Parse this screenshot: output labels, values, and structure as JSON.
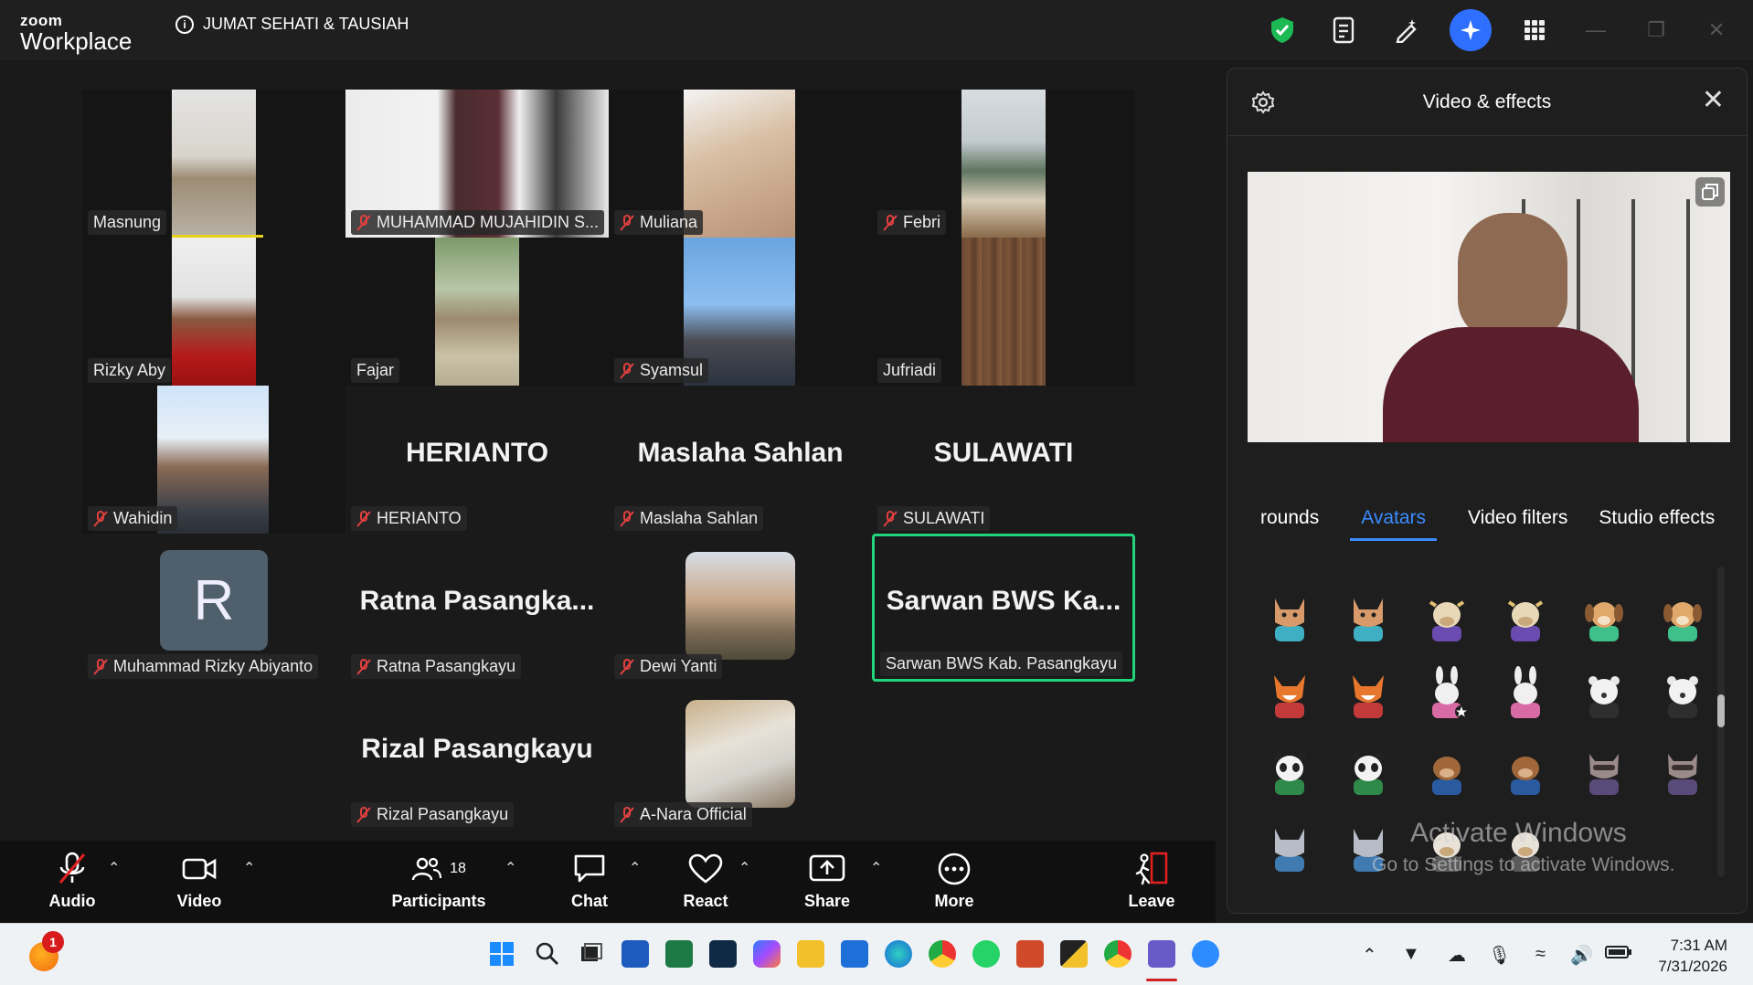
{
  "titlebar": {
    "brand_top": "zoom",
    "brand_bottom": "Workplace",
    "meeting_title": "JUMAT SEHATI & TAUSIAH",
    "icons": [
      "shield-check-icon",
      "notes-icon",
      "whiteboard-pen-icon",
      "ai-companion-icon",
      "apps-grid-icon"
    ]
  },
  "participants": {
    "masnung": "Masnung",
    "mujahidin": "MUHAMMAD MUJAHIDIN S...",
    "muliana": "Muliana",
    "febri": "Febri",
    "rizky_aby": "Rizky Aby",
    "fajar": "Fajar",
    "syamsul": "Syamsul",
    "jufriadi": "Jufriadi",
    "wahidin": "Wahidin",
    "herianto_big": "HERIANTO",
    "herianto": "HERIANTO",
    "maslaha_big": "Maslaha Sahlan",
    "maslaha": "Maslaha Sahlan",
    "sulawati_big": "SULAWATI",
    "sulawati": "SULAWATI",
    "rizky_abiyanto_initial": "R",
    "rizky_abiyanto": "Muhammad Rizky Abiyanto",
    "ratna_big": "Ratna  Pasangka...",
    "ratna": "Ratna Pasangkayu",
    "dewi": "Dewi Yanti",
    "sarwan_big": "Sarwan  BWS  Ka...",
    "sarwan": "Sarwan BWS Kab. Pasangkayu",
    "rizal_big": "Rizal Pasangkayu",
    "rizal": "Rizal Pasangkayu",
    "anara": "A-Nara Official"
  },
  "toolbar": {
    "audio": "Audio",
    "video": "Video",
    "participants": "Participants",
    "participants_count": "18",
    "chat": "Chat",
    "react": "React",
    "share": "Share",
    "more": "More",
    "leave": "Leave"
  },
  "panel": {
    "title": "Video & effects",
    "tabs": [
      "rounds",
      "Avatars",
      "Video filters",
      "Studio effects"
    ],
    "selected_tab": "Avatars"
  },
  "watermark": {
    "line1": "Activate Windows",
    "line2": "Go to Settings to activate Windows."
  },
  "taskbar": {
    "notification_badge": "1",
    "time": "7:31 AM",
    "date": "7/31/2026"
  },
  "colors": {
    "accent_blue": "#3b8bff",
    "active_speaker": "#22d47a",
    "leave_red": "#e02020",
    "muted_red": "#e04040"
  }
}
